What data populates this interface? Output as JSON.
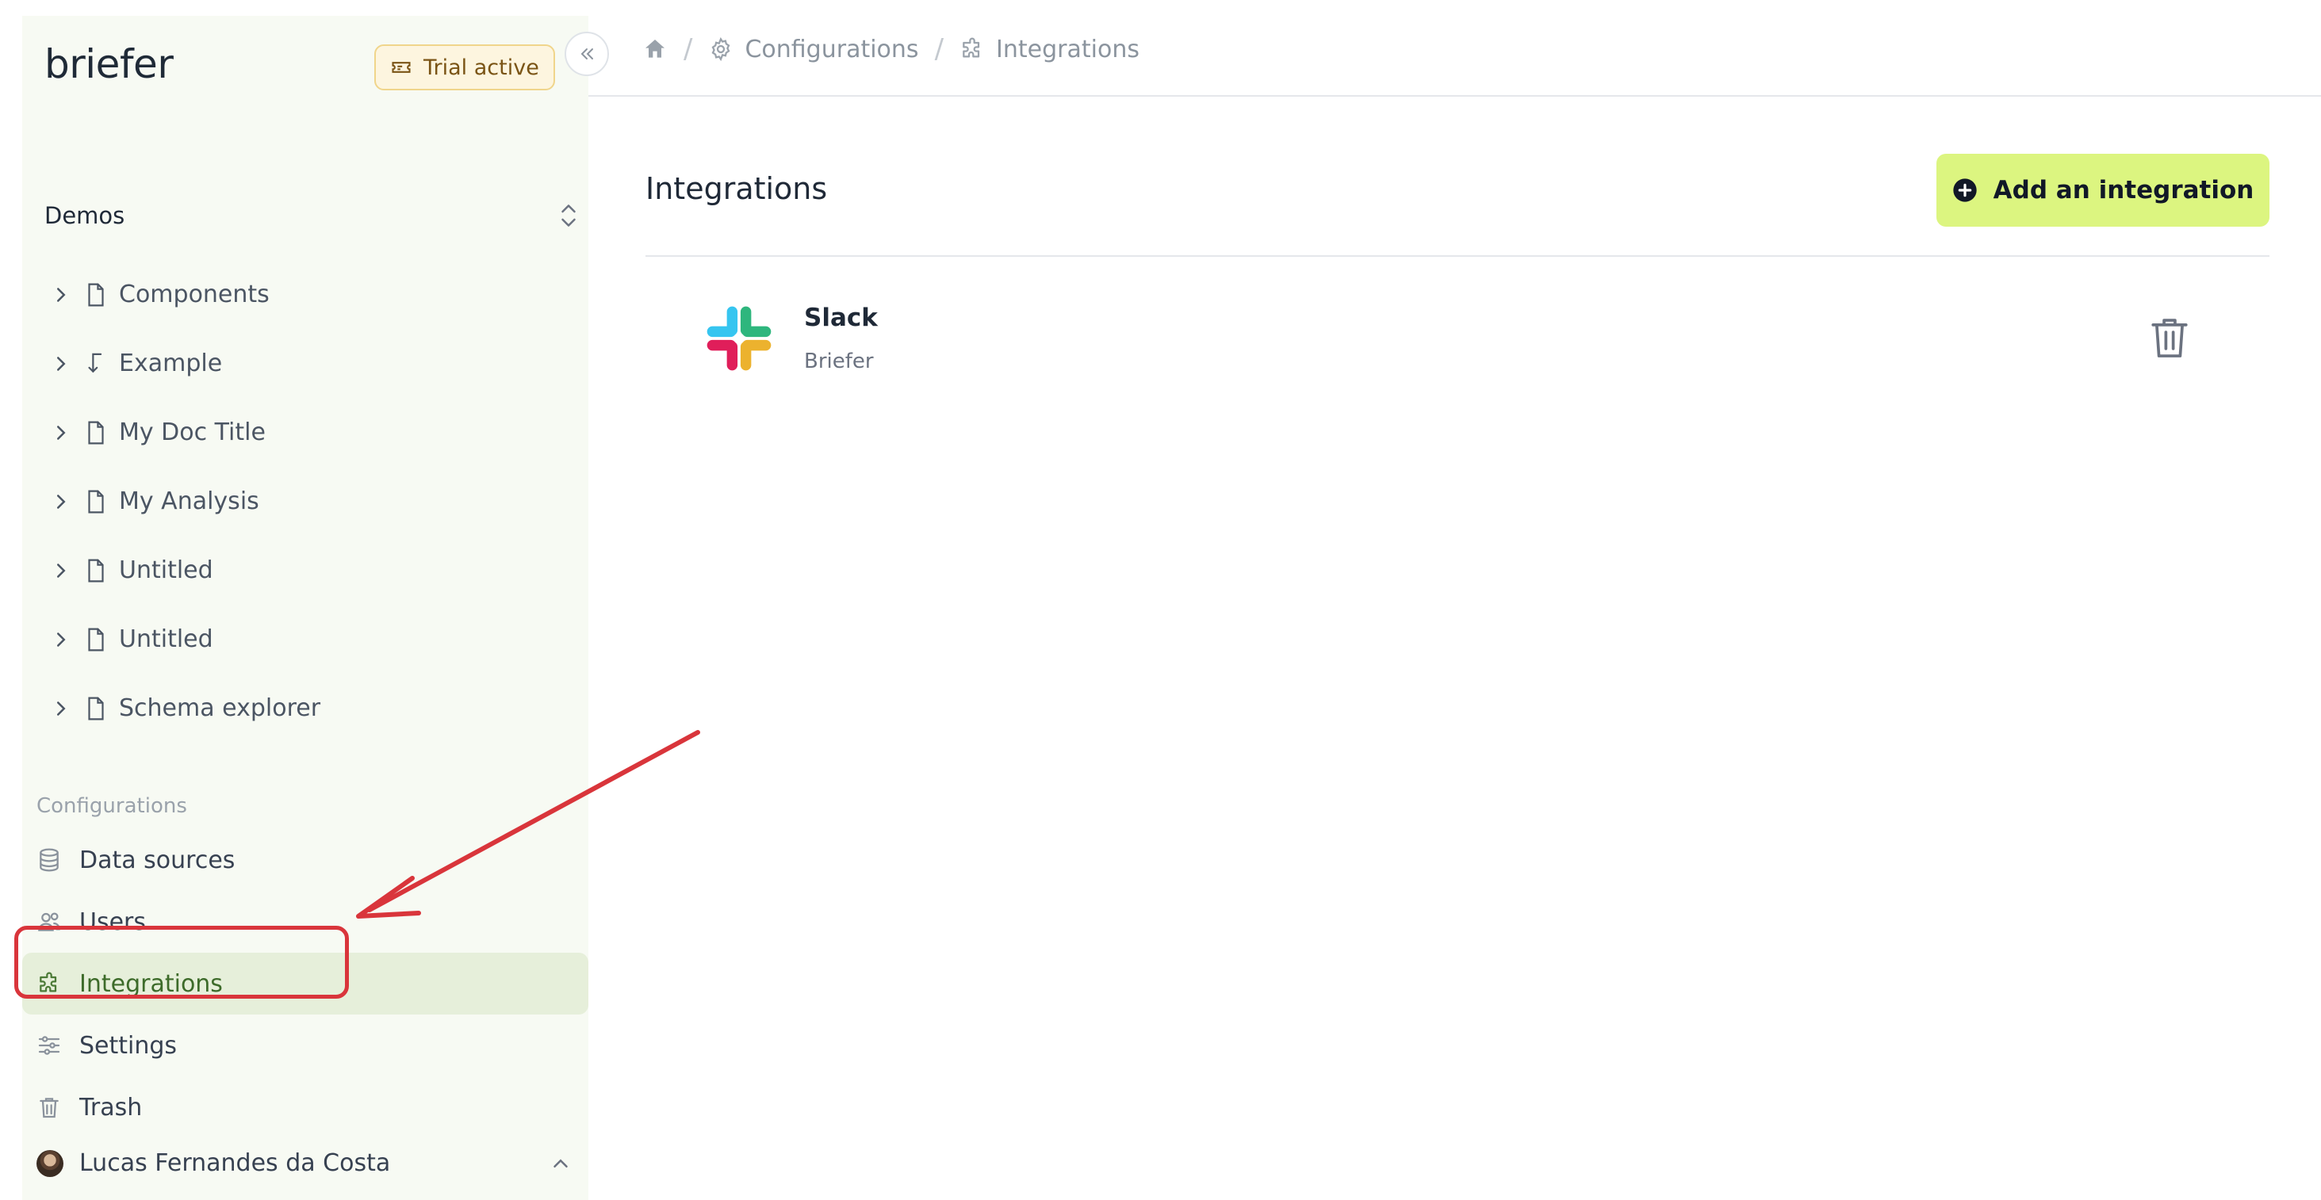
{
  "app": {
    "logo": "briefer",
    "trial_badge": "Trial active"
  },
  "sidebar": {
    "workspace": "Demos",
    "documents": [
      {
        "label": "Components",
        "icon": "document-icon"
      },
      {
        "label": "Example",
        "icon": "branch-arrow-icon"
      },
      {
        "label": "My Doc Title",
        "icon": "document-icon"
      },
      {
        "label": "My Analysis",
        "icon": "document-icon"
      },
      {
        "label": "Untitled",
        "icon": "document-icon"
      },
      {
        "label": "Untitled",
        "icon": "document-icon"
      },
      {
        "label": "Schema explorer",
        "icon": "document-icon"
      }
    ],
    "config_heading": "Configurations",
    "config_items": [
      {
        "label": "Data sources",
        "icon": "database-icon",
        "active": false
      },
      {
        "label": "Users",
        "icon": "users-icon",
        "active": false
      },
      {
        "label": "Integrations",
        "icon": "puzzle-icon",
        "active": true
      },
      {
        "label": "Settings",
        "icon": "sliders-icon",
        "active": false
      },
      {
        "label": "Trash",
        "icon": "trash-icon",
        "active": false
      }
    ],
    "user": {
      "name": "Lucas Fernandes da Costa"
    }
  },
  "breadcrumb": {
    "items": [
      {
        "label": "",
        "icon": "home-icon"
      },
      {
        "label": "Configurations",
        "icon": "gear-icon"
      },
      {
        "label": "Integrations",
        "icon": "puzzle-icon"
      }
    ]
  },
  "main": {
    "title": "Integrations",
    "add_button": "Add an integration",
    "integrations": [
      {
        "name": "Slack",
        "workspace": "Briefer",
        "icon": "slack-logo"
      }
    ]
  },
  "colors": {
    "sidebar_bg": "#f7faf3",
    "active_bg": "#e6efda",
    "accent_button": "#dcf580",
    "annotation_red": "#d9353b"
  }
}
